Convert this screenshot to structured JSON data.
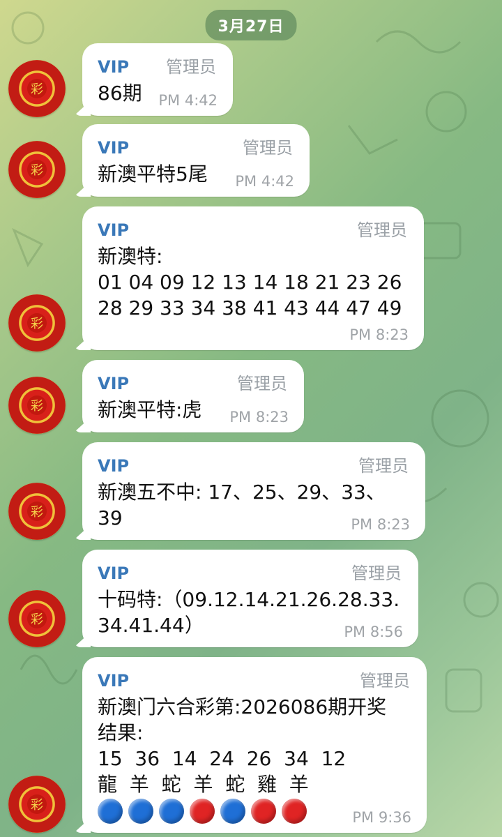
{
  "date_label": "3月27日",
  "messages": [
    {
      "sender": "VIP",
      "role": "管理员",
      "text": "86期",
      "time": "PM 4:42"
    },
    {
      "sender": "VIP",
      "role": "管理员",
      "text": "新澳平特5尾",
      "time": "PM 4:42"
    },
    {
      "sender": "VIP",
      "role": "管理员",
      "text": "新澳特:\n01 04 09 12 13 14 18 21 23 26\n28 29 33 34 38 41 43 44 47 49",
      "time": "PM 8:23"
    },
    {
      "sender": "VIP",
      "role": "管理员",
      "text": "新澳平特:虎",
      "time": "PM 8:23"
    },
    {
      "sender": "VIP",
      "role": "管理员",
      "text": "新澳五不中: 17、25、29、33、\n39",
      "time": "PM 8:23"
    },
    {
      "sender": "VIP",
      "role": "管理员",
      "text": "十码特:（09.12.14.21.26.28.33.\n34.41.44）",
      "time": "PM 8:56"
    },
    {
      "sender": "VIP",
      "role": "管理员",
      "text": "新澳门六合彩第:2026086期开奖\n结果:\n15  36  14  24  26  34  12\n龍  羊  蛇  羊  蛇  雞  羊",
      "time": "PM 9:36",
      "balls": [
        "blue",
        "blue",
        "blue",
        "red",
        "blue",
        "red",
        "red"
      ]
    }
  ],
  "colors": {
    "ball_blue": "#1f6fd6",
    "ball_red": "#e02424",
    "sender": "#3a78b8"
  },
  "icons": {
    "avatar": "lottery-logo-avatar"
  }
}
